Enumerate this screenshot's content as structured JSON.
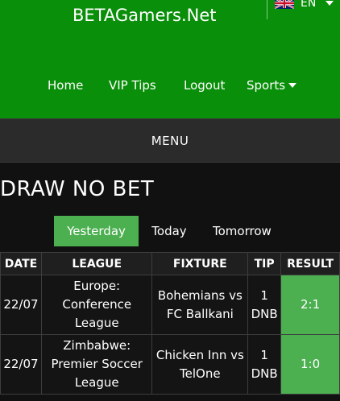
{
  "header": {
    "site_title": "BETAGamers.Net",
    "language": "EN",
    "bg_color": "#0a8f0a"
  },
  "nav": {
    "items": [
      {
        "label": "Home"
      },
      {
        "label": "VIP Tips"
      },
      {
        "label": "Logout"
      },
      {
        "label": "Sports",
        "icon": "caret-down-icon"
      }
    ]
  },
  "menu": {
    "label": "MENU"
  },
  "page": {
    "title": "DRAW NO BET"
  },
  "tabs": [
    {
      "label": "Yesterday",
      "active": true
    },
    {
      "label": "Today",
      "active": false
    },
    {
      "label": "Tomorrow",
      "active": false
    }
  ],
  "table": {
    "headers": [
      "DATE",
      "LEAGUE",
      "FIXTURE",
      "TIP",
      "RESULT"
    ],
    "rows": [
      {
        "date": "22/07",
        "league": "Europe: Conference League",
        "fixture": "Bohemians vs FC Ballkani",
        "tip": "1 DNB",
        "result": "2:1",
        "status": "won"
      },
      {
        "date": "22/07",
        "league": "Zimbabwe: Premier Soccer League",
        "fixture": "Chicken Inn vs TelOne",
        "tip": "1 DNB",
        "result": "1:0",
        "status": "won"
      }
    ],
    "win_color": "#4caf50"
  }
}
